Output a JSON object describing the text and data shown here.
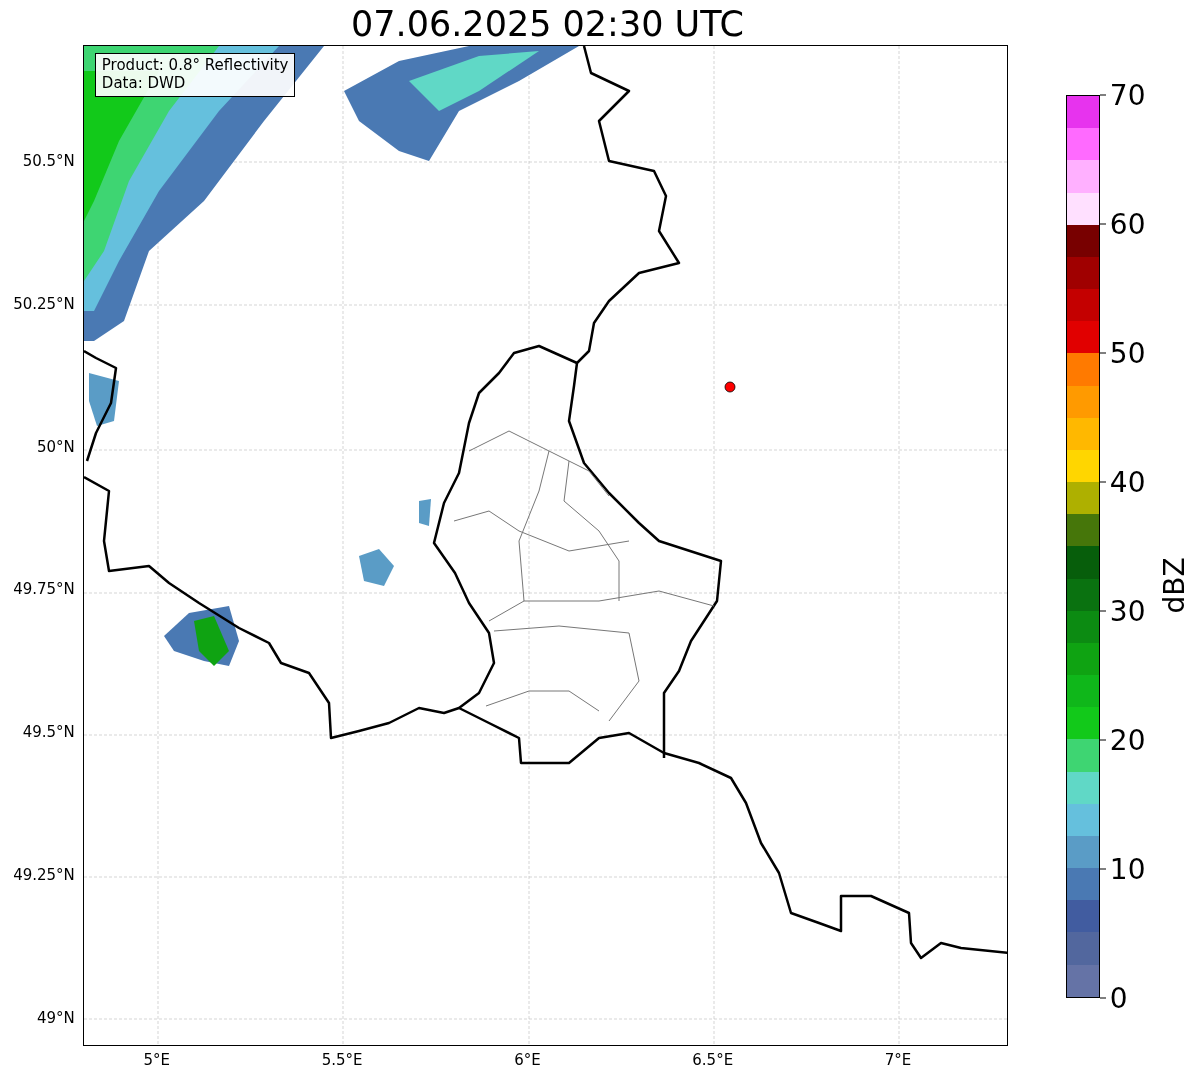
{
  "title": "07.06.2025 02:30 UTC",
  "legend": {
    "lines": [
      "Product: 0.8° Reflectivity",
      "Data: DWD"
    ]
  },
  "y_ticks": [
    "50.5°N",
    "50.25°N",
    "50°N",
    "49.75°N",
    "49.5°N",
    "49.25°N",
    "49°N"
  ],
  "x_ticks": [
    "5°E",
    "5.5°E",
    "6°E",
    "6.5°E",
    "7°E"
  ],
  "colorbar": {
    "label": "dBZ",
    "ticks": [
      "70",
      "60",
      "50",
      "40",
      "30",
      "20",
      "10",
      "0"
    ],
    "segments": [
      {
        "color": "#e733ee"
      },
      {
        "color": "#ff6aff"
      },
      {
        "color": "#ffb0ff"
      },
      {
        "color": "#ffe0ff"
      },
      {
        "color": "#780000"
      },
      {
        "color": "#a00000"
      },
      {
        "color": "#c40000"
      },
      {
        "color": "#e10000"
      },
      {
        "color": "#ff7a00"
      },
      {
        "color": "#ff9a00"
      },
      {
        "color": "#ffb800"
      },
      {
        "color": "#ffd600"
      },
      {
        "color": "#aeb000"
      },
      {
        "color": "#46760a"
      },
      {
        "color": "#075e0b"
      },
      {
        "color": "#0a7210"
      },
      {
        "color": "#0c8b12"
      },
      {
        "color": "#0fa312"
      },
      {
        "color": "#0fb71a"
      },
      {
        "color": "#12c91a"
      },
      {
        "color": "#3ed572"
      },
      {
        "color": "#60d8c6"
      },
      {
        "color": "#65c0dd"
      },
      {
        "color": "#5a9cc6"
      },
      {
        "color": "#4a79b3"
      },
      {
        "color": "#415ca0"
      },
      {
        "color": "#52679e"
      },
      {
        "color": "#6573a6"
      }
    ]
  }
}
